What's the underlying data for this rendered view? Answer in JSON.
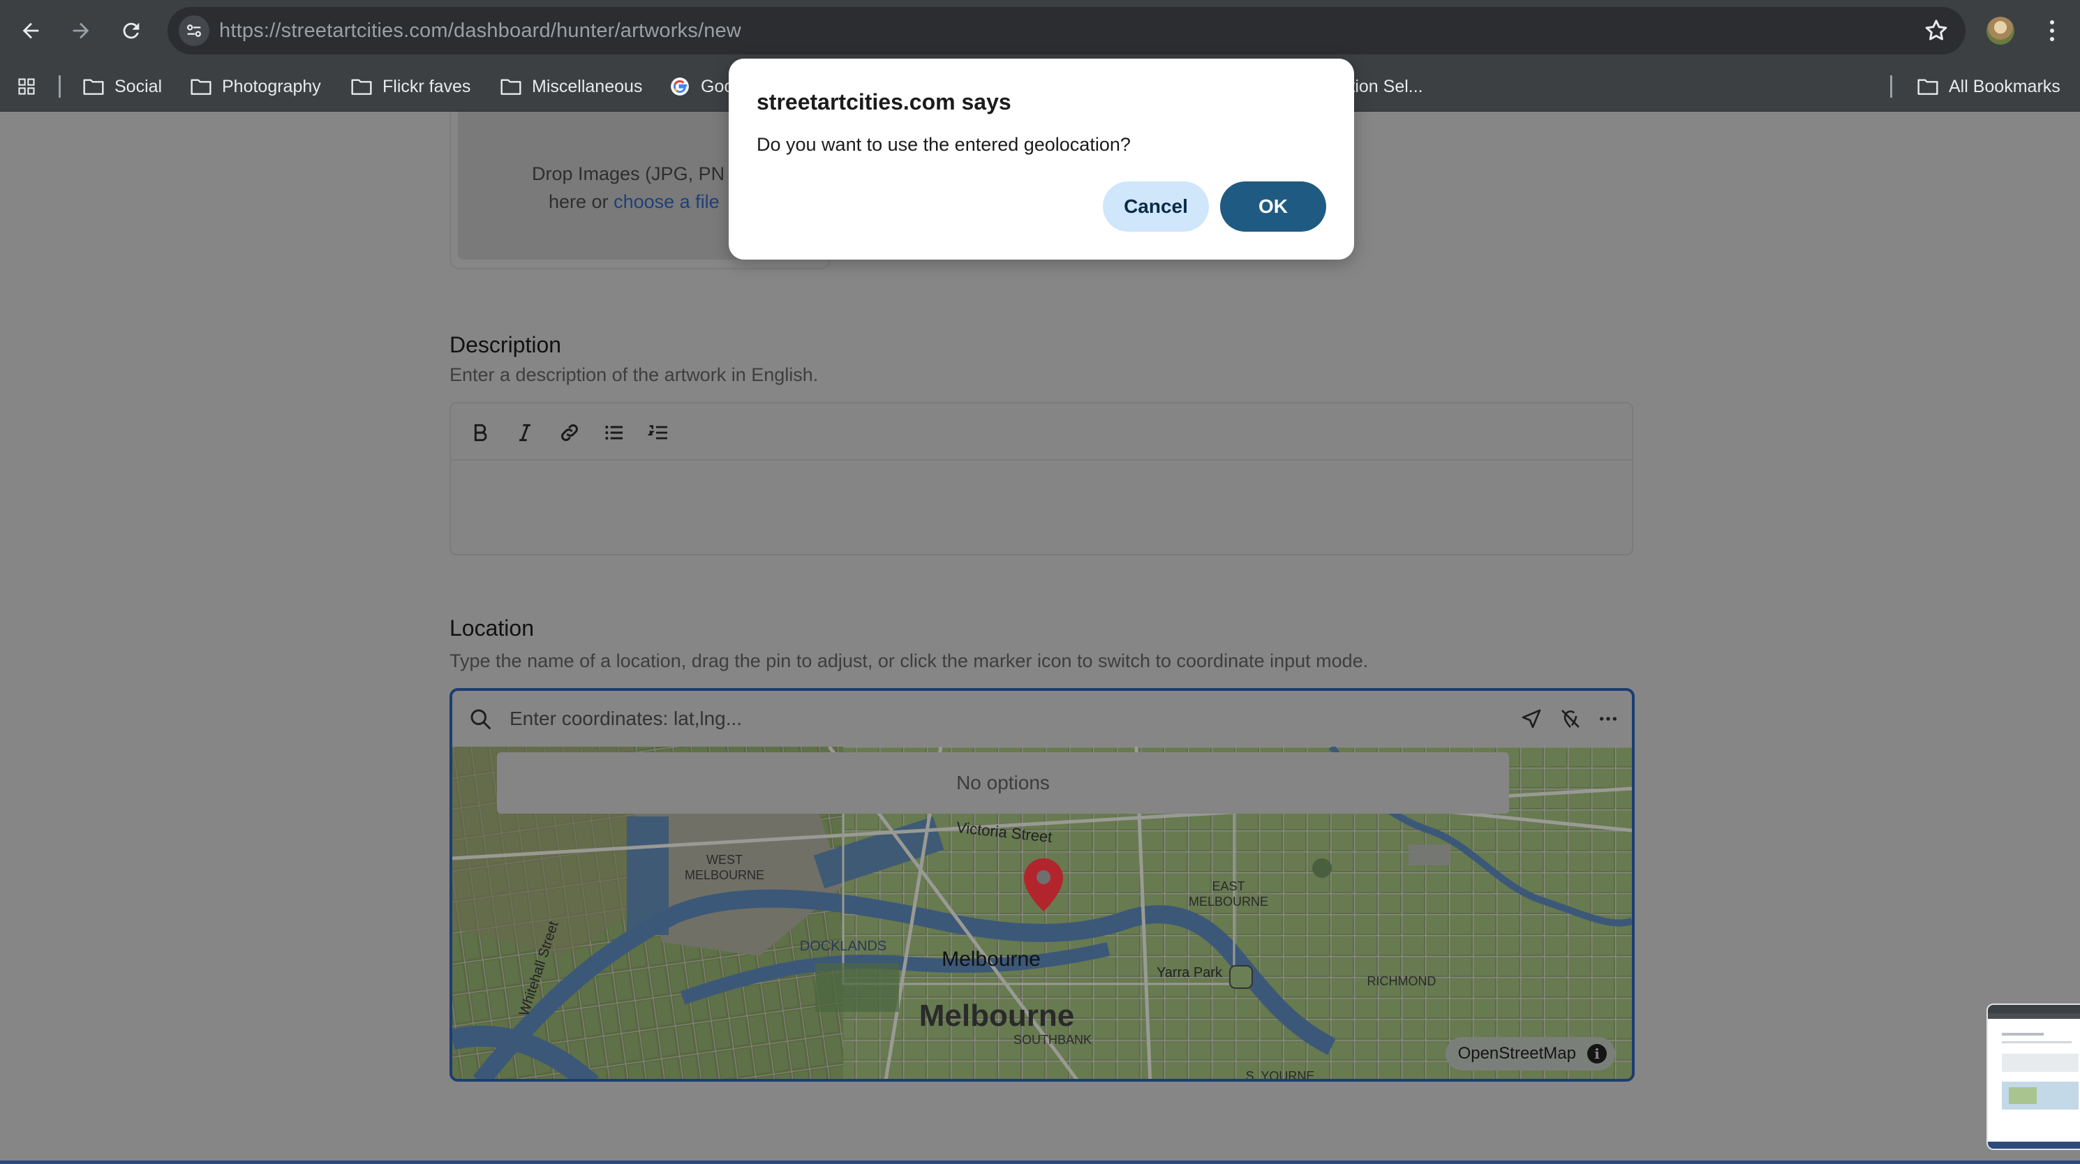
{
  "browser": {
    "url_host": "https://streetartcities.com",
    "url_path": "/dashboard/hunter/artworks/new",
    "bookmarks": [
      "Social",
      "Photography",
      "Flickr faves",
      "Miscellaneous",
      "Goo",
      "ection Sel..."
    ],
    "all_bookmarks": "All Bookmarks"
  },
  "page": {
    "dropzone": {
      "line1": "Drop Images (JPG, PN",
      "line2_prefix": "here or ",
      "line2_link": "choose a file"
    },
    "description": {
      "title": "Description",
      "subtitle": "Enter a description of the artwork in English."
    },
    "location": {
      "title": "Location",
      "subtitle": "Type the name of a location, drag the pin to adjust, or click the marker icon to switch to coordinate input mode.",
      "input_placeholder": "Enter coordinates: lat,lng...",
      "no_options": "No options",
      "attribution": "OpenStreetMap",
      "map_labels": {
        "city": "Melbourne",
        "victoria_street": "Victoria Street",
        "west_melbourne_1": "WEST",
        "west_melbourne_2": "MELBOURNE",
        "whiteman_street": "Whitehall Street",
        "docklands": "DOCKLANDS",
        "east_melbourne_1": "EAST",
        "east_melbourne_2": "MELBOURNE",
        "yarra_park": "Yarra Park",
        "richmond": "RICHMOND",
        "southbank": "SOUTHBANK",
        "south_melbourne": "S. YOURNE"
      }
    }
  },
  "dialog": {
    "title": "streetartcities.com says",
    "message": "Do you want to use the entered geolocation?",
    "cancel_label": "Cancel",
    "ok_label": "OK"
  },
  "colors": {
    "dialog_ok": "#1f5a82",
    "dialog_cancel": "#cfe6fb",
    "map_border": "#1c3c73",
    "pin": "#b3252c"
  }
}
